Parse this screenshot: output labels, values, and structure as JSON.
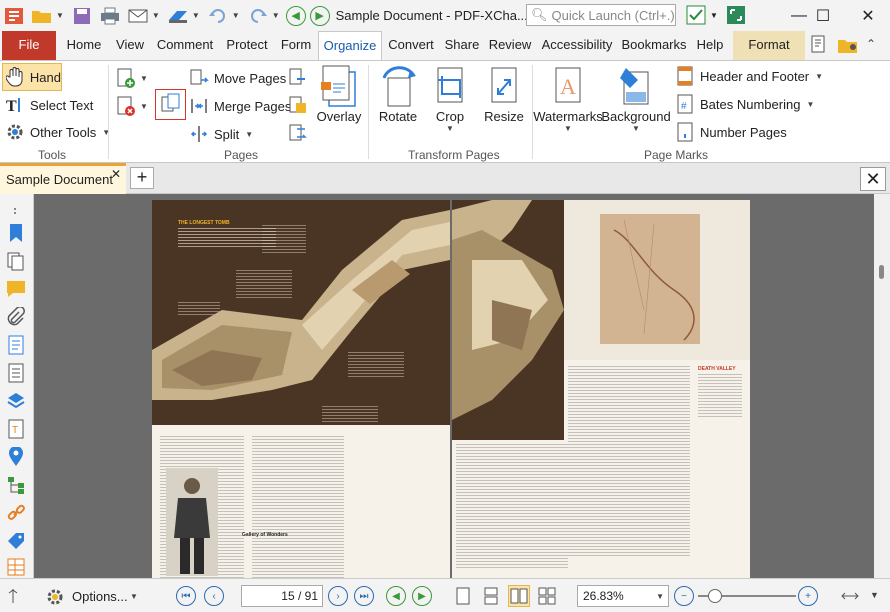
{
  "window": {
    "title": "Sample Document - PDF-XCha...",
    "search_placeholder": "Quick Launch (Ctrl+.)",
    "minimize_glyph": "—",
    "maximize_glyph": "☐",
    "close_glyph": "✕"
  },
  "tabs": {
    "file": "File",
    "home": "Home",
    "view": "View",
    "comment": "Comment",
    "protect": "Protect",
    "form": "Form",
    "organize": "Organize",
    "convert": "Convert",
    "share": "Share",
    "review": "Review",
    "accessibility": "Accessibility",
    "bookmarks": "Bookmarks",
    "help": "Help",
    "format": "Format"
  },
  "ribbon": {
    "tools": {
      "hand": "Hand",
      "select_text": "Select Text",
      "other_tools": "Other Tools",
      "group": "Tools"
    },
    "pages": {
      "move_pages": "Move Pages",
      "merge_pages": "Merge Pages",
      "split": "Split",
      "overlay": "Overlay",
      "group": "Pages"
    },
    "transform": {
      "rotate": "Rotate",
      "crop": "Crop",
      "resize": "Resize",
      "group": "Transform Pages"
    },
    "marks": {
      "watermarks": "Watermarks",
      "background": "Background",
      "header_footer": "Header and Footer",
      "bates": "Bates Numbering",
      "page_number": "Number Pages",
      "group": "Page Marks"
    }
  },
  "document": {
    "tab_name": "Sample Document",
    "tab_close": "✕",
    "new_tab": "+",
    "close": "✕",
    "article": {
      "heading": "THE LONGEST TOMB",
      "caption_right": "DEATH VALLEY",
      "photo_caption": "Gallery of Wonders"
    }
  },
  "status": {
    "options": "Options...",
    "page_current": "15",
    "page_total": "/ 91",
    "zoom": "26.83%"
  },
  "colors": {
    "file_tab": "#c0392b",
    "accent_blue": "#1b5ba8",
    "doc_tab_accent": "#e8a33b",
    "format_tab": "#efe0b5",
    "nav_green": "#3a9a3a"
  }
}
